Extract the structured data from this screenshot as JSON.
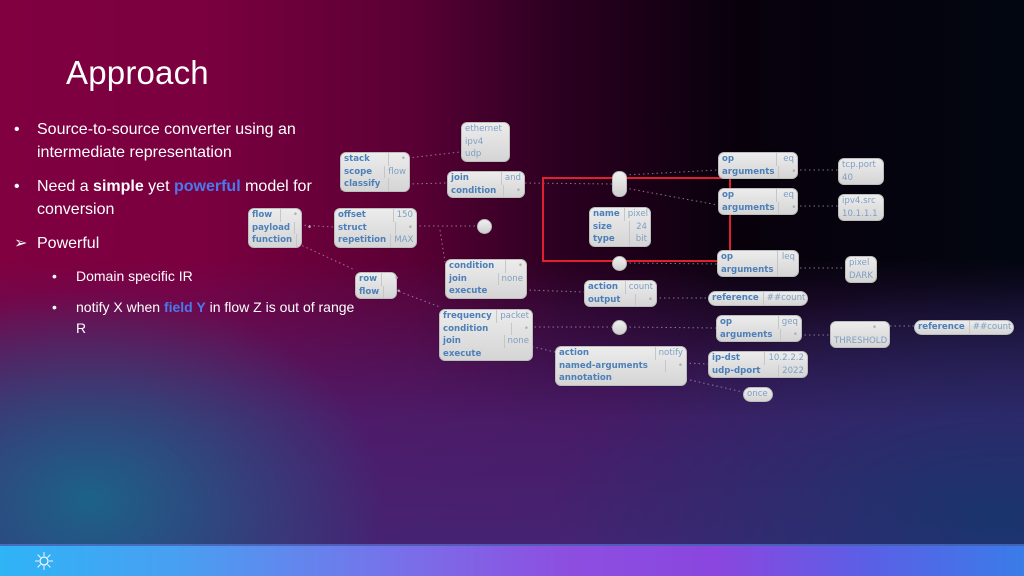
{
  "slide": {
    "title": "Approach",
    "bullets": [
      {
        "marker": "•",
        "text": "Source-to-source converter using an intermediate representation"
      },
      {
        "marker": "•",
        "parts": [
          "Need a ",
          "simple",
          " yet ",
          "powerful",
          " model for conversion"
        ]
      },
      {
        "marker": "➢",
        "text": "Powerful"
      },
      {
        "marker": "•",
        "text": "Domain specific IR"
      },
      {
        "marker": "•",
        "parts": [
          "notify X when ",
          "field Y",
          " in flow Z is out of range R"
        ]
      }
    ]
  },
  "diagram": {
    "colors": {
      "highlight": "#4a78ee",
      "selection_box": "#e02030",
      "key_text": "#4d7fb8",
      "value_text": "#7e9fc2"
    },
    "nodes": {
      "ethernet_list": [
        "ethernet",
        "ipv4",
        "udp"
      ],
      "stack": [
        [
          "stack",
          ""
        ],
        [
          "scope",
          "flow"
        ],
        [
          "classify",
          ""
        ]
      ],
      "join_and": [
        [
          "join",
          "and"
        ],
        [
          "condition",
          ""
        ]
      ],
      "flow_payload": [
        [
          "flow",
          ""
        ],
        [
          "payload",
          ""
        ],
        [
          "function",
          ""
        ]
      ],
      "offset": [
        [
          "offset",
          "150"
        ],
        [
          "struct",
          ""
        ],
        [
          "repetition",
          "MAX"
        ]
      ],
      "pixel_struct": [
        [
          "name",
          "pixel"
        ],
        [
          "size",
          "24"
        ],
        [
          "type",
          "bit"
        ]
      ],
      "op_eq_1": [
        [
          "op",
          "eq"
        ],
        [
          "arguments",
          ""
        ]
      ],
      "tcp_port": [
        "tcp.port",
        "40"
      ],
      "op_eq_2": [
        [
          "op",
          "eq"
        ],
        [
          "arguments",
          ""
        ]
      ],
      "ipv4_src": [
        "ipv4.src",
        "10.1.1.1"
      ],
      "op_leq": [
        [
          "op",
          "leq"
        ],
        [
          "arguments",
          ""
        ]
      ],
      "pixel_dark": [
        "pixel",
        "DARK"
      ],
      "row_flow": [
        [
          "row",
          ""
        ],
        [
          "flow",
          ""
        ]
      ],
      "cond_join_none": [
        [
          "condition",
          ""
        ],
        [
          "join",
          "none"
        ],
        [
          "execute",
          ""
        ]
      ],
      "action_count": [
        [
          "action",
          "count"
        ],
        [
          "output",
          ""
        ]
      ],
      "reference_count_1": [
        [
          "reference",
          "##count"
        ]
      ],
      "frequency": [
        [
          "frequency",
          "packet"
        ],
        [
          "condition",
          ""
        ],
        [
          "join",
          "none"
        ],
        [
          "execute",
          ""
        ]
      ],
      "op_geq": [
        [
          "op",
          "geq"
        ],
        [
          "arguments",
          ""
        ]
      ],
      "threshold": [
        "",
        "THRESHOLD"
      ],
      "reference_count_2": [
        [
          "reference",
          "##count"
        ]
      ],
      "action_notify": [
        [
          "action",
          "notify"
        ],
        [
          "named-arguments",
          ""
        ],
        [
          "annotation",
          ""
        ]
      ],
      "ip_dst": [
        [
          "ip-dst",
          "10.2.2.2"
        ],
        [
          "udp-dport",
          "2022"
        ]
      ],
      "once": [
        "once"
      ]
    }
  },
  "footer": {
    "logo_icon": "sunburst-logo-icon"
  }
}
